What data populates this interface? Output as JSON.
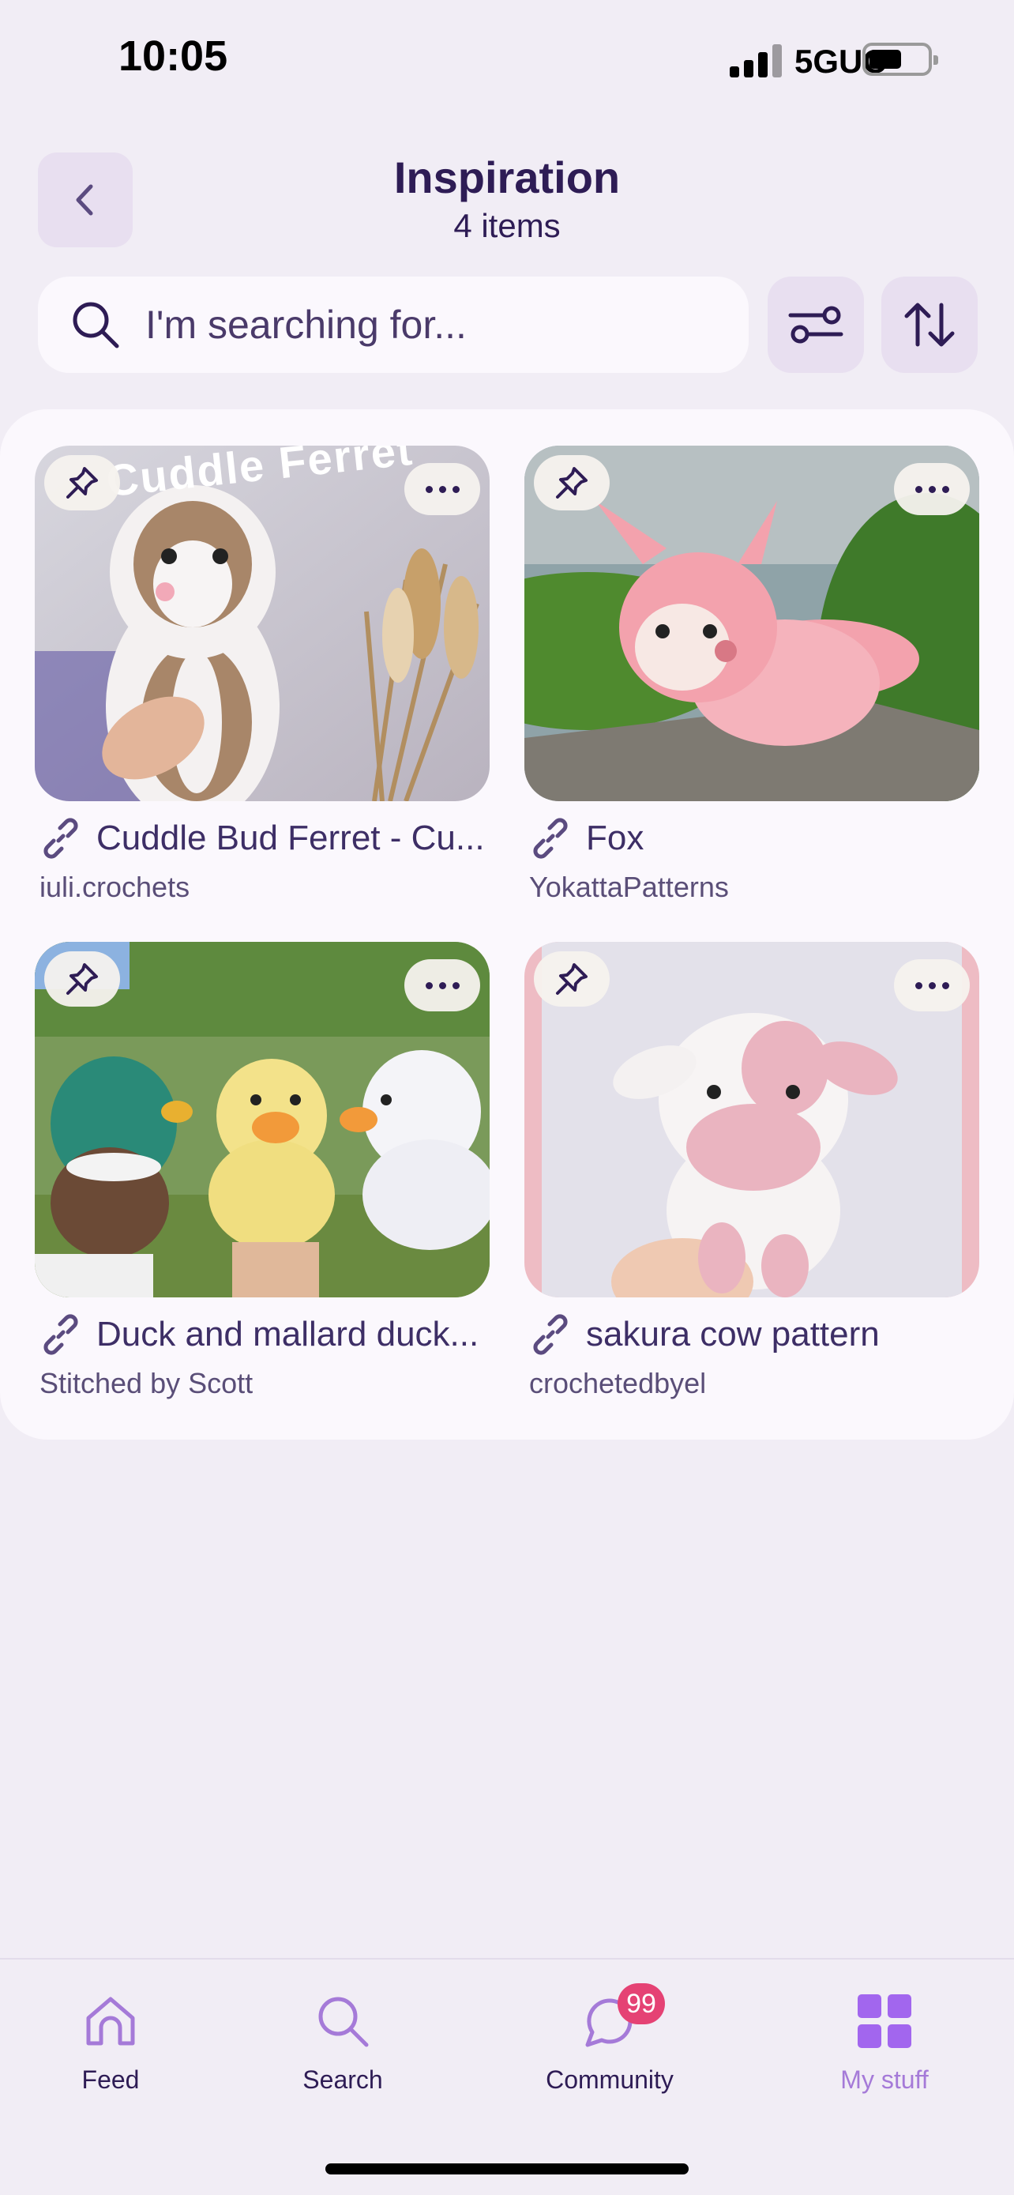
{
  "status_bar": {
    "time": "10:05",
    "network": "5GUC",
    "battery_level": 0.55
  },
  "header": {
    "title": "Inspiration",
    "subtitle": "4 items",
    "back_icon": "chevron-left-icon"
  },
  "search": {
    "placeholder": "I'm searching for...",
    "value": "",
    "filter_icon": "filter-sliders-icon",
    "sort_icon": "sort-arrows-icon"
  },
  "items": [
    {
      "title": "Cuddle Bud Ferret - Cu...",
      "source": "iuli.crochets",
      "banner": "Cuddle Ferret"
    },
    {
      "title": "Fox",
      "source": "YokattaPatterns"
    },
    {
      "title": "Duck and mallard duck...",
      "source": "Stitched by Scott"
    },
    {
      "title": "sakura cow pattern",
      "source": "crochetedbyel"
    }
  ],
  "nav": {
    "items": [
      {
        "label": "Feed",
        "icon": "home-icon"
      },
      {
        "label": "Search",
        "icon": "search-icon"
      },
      {
        "label": "Community",
        "icon": "chat-bubble-icon",
        "badge": "99"
      },
      {
        "label": "My stuff",
        "icon": "grid-icon",
        "active": true
      }
    ]
  },
  "colors": {
    "background": "#f1edf5",
    "card": "#fbf8fd",
    "primary_text": "#2e1c55",
    "accent": "#a57ad8",
    "badge": "#e54274"
  }
}
